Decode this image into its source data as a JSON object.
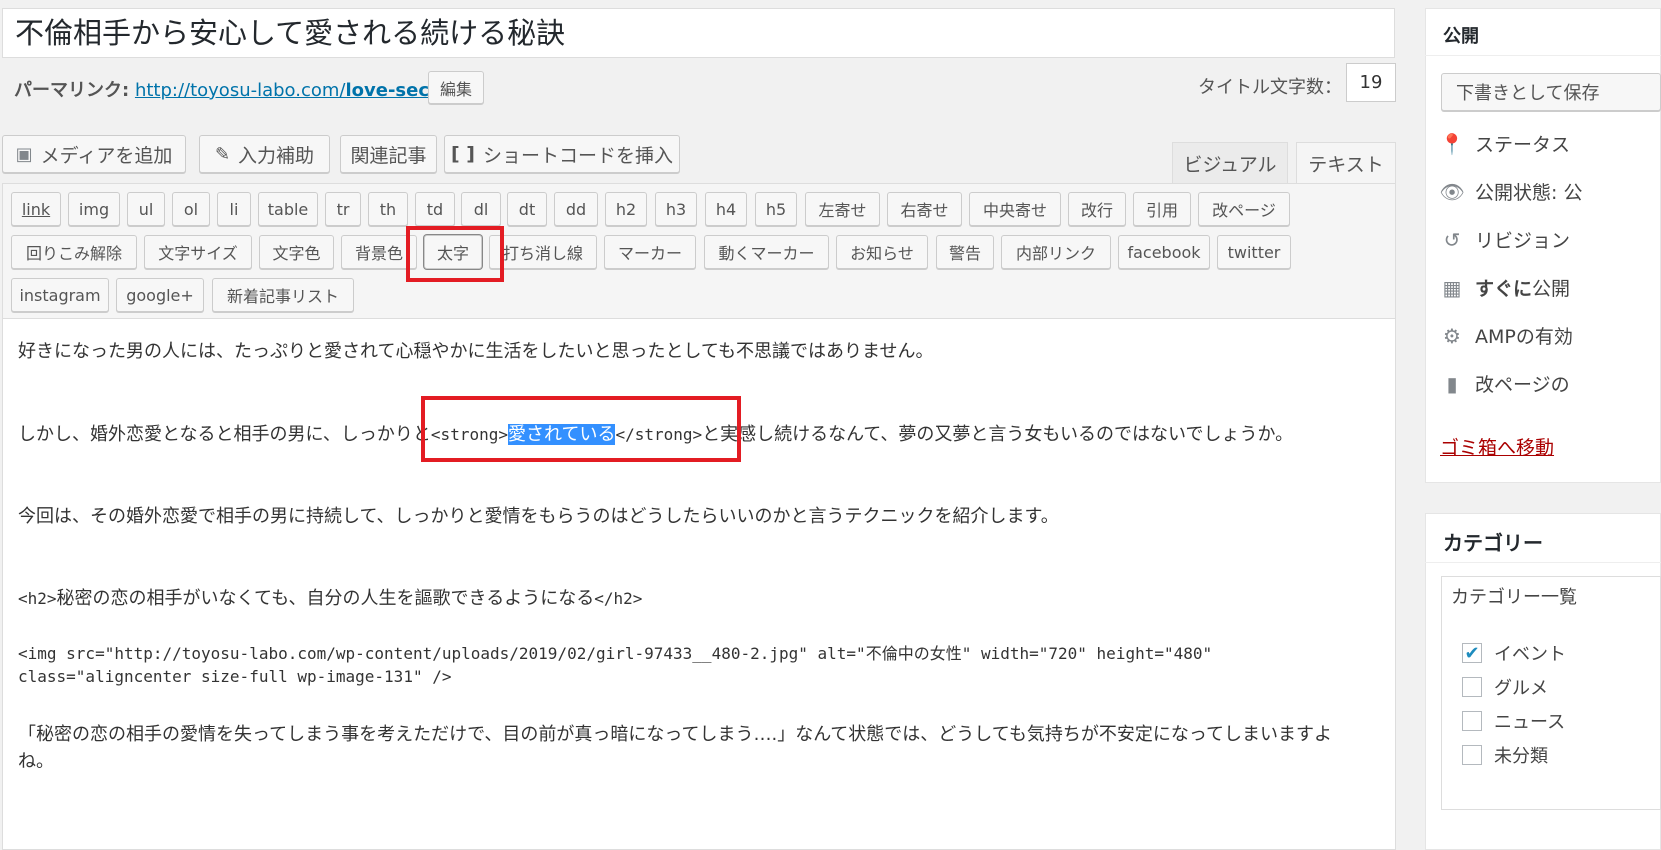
{
  "title": "不倫相手から安心して愛される続ける秘訣",
  "permalink": {
    "label": "パーマリンク:",
    "url_base": "http://toyosu-labo.com/",
    "url_slug": "love-secret",
    "edit_label": "編集"
  },
  "title_count": {
    "label": "タイトル文字数：",
    "value": "19"
  },
  "media_buttons": [
    {
      "label": "メディアを追加",
      "icon": "media-icon"
    },
    {
      "label": "入力補助",
      "icon": "pencil-icon"
    },
    {
      "label": "関連記事"
    },
    {
      "label": "ショートコードを挿入",
      "icon": "brackets-icon"
    }
  ],
  "tabs": {
    "visual": "ビジュアル",
    "text": "テキスト"
  },
  "quicktags": {
    "row1": [
      "link",
      "img",
      "ul",
      "ol",
      "li",
      "table",
      "tr",
      "th",
      "td",
      "dl",
      "dt",
      "dd",
      "h2",
      "h3",
      "h4",
      "h5",
      "左寄せ",
      "右寄せ",
      "中央寄せ",
      "改行",
      "引用",
      "改ページ"
    ],
    "row2": [
      "回りこみ解除",
      "文字サイズ",
      "文字色",
      "背景色",
      "太字",
      "打ち消し線",
      "マーカー",
      "動くマーカー",
      "お知らせ",
      "警告",
      "内部リンク",
      "facebook",
      "twitter"
    ],
    "row3": [
      "instagram",
      "google+",
      "新着記事リスト"
    ]
  },
  "content": {
    "p1": "好きになった男の人には、たっぷりと愛されて心穏やかに生活をしたいと思ったとしても不思議ではありません。",
    "p2_before": "しかし、婚外恋愛となると相手の男に、しっかりと",
    "p2_tag_open": "<strong>",
    "p2_selected": "愛されている",
    "p2_tag_close": "</strong>",
    "p2_after": "と実感し続けるなんて、夢の又夢と言う女もいるのではないでしょうか。",
    "p3": "今回は、その婚外恋愛で相手の男に持続して、しっかりと愛情をもらうのはどうしたらいいのかと言うテクニックを紹介します。",
    "h2_open": "<h2>",
    "h2_text": "秘密の恋の相手がいなくても、自分の人生を謳歌できるようになる",
    "h2_close": "</h2>",
    "img_line1": "<img src=\"http://toyosu-labo.com/wp-content/uploads/2019/02/girl-97433__480-2.jpg\" alt=\"不倫中の女性\" width=\"720\" height=\"480\"",
    "img_line2": "class=\"aligncenter size-full wp-image-131\" />",
    "p4_line1": "「秘密の恋の相手の愛情を失ってしまう事を考えただけで、目の前が真っ暗になってしまう….」なんて状態では、どうしても気持ちが不安定になってしまいますよ",
    "p4_line2": "ね。"
  },
  "publish": {
    "title": "公開",
    "draft_button": "下書きとして保存",
    "status": "ステータス",
    "visibility": "公開状態: 公",
    "revisions": "リビジョン",
    "schedule_bold": "すぐに",
    "schedule_rest": "公開",
    "amp": "AMPの有効",
    "page_break": "改ページの",
    "trash": "ゴミ箱へ移動"
  },
  "categories": {
    "title": "カテゴリー",
    "tab_all": "カテゴリー一覧",
    "items": [
      {
        "label": "イベント",
        "checked": true
      },
      {
        "label": "グルメ",
        "checked": false
      },
      {
        "label": "ニュース",
        "checked": false
      },
      {
        "label": "未分類",
        "checked": false
      }
    ]
  }
}
